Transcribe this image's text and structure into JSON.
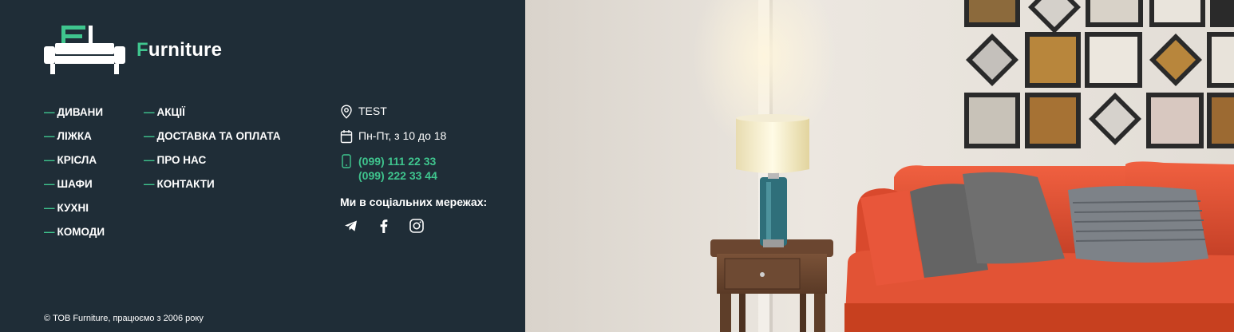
{
  "brand": {
    "name_first": "F",
    "name_rest": "urniture",
    "accent": "#3fc58e",
    "background": "#1f2d37"
  },
  "nav_col1": [
    {
      "dash": "—",
      "label": "ДИВАНИ"
    },
    {
      "dash": "—",
      "label": "ЛІЖКА"
    },
    {
      "dash": "—",
      "label": "КРІСЛА"
    },
    {
      "dash": "—",
      "label": "ШАФИ"
    },
    {
      "dash": "—",
      "label": "КУХНІ"
    },
    {
      "dash": "—",
      "label": "КОМОДИ"
    }
  ],
  "nav_col2": [
    {
      "dash": "—",
      "label": "АКЦІЇ"
    },
    {
      "dash": "—",
      "label": "ДОСТАВКА ТА ОПЛАТА"
    },
    {
      "dash": "—",
      "label": "ПРО НАС"
    },
    {
      "dash": "—",
      "label": "КОНТАКТИ"
    }
  ],
  "contacts": {
    "address": "TEST",
    "hours": "Пн-Пт, з 10 до 18",
    "phones": [
      "(099) 111 22 33",
      "(099) 222 33 44"
    ],
    "address_icon": "location-pin-icon",
    "hours_icon": "calendar-icon",
    "phone_icon": "mobile-phone-icon"
  },
  "social": {
    "title": "Ми в соціальних мережах:",
    "items": [
      "telegram-icon",
      "facebook-icon",
      "instagram-icon"
    ]
  },
  "copyright": "© ТОВ Furniture, працюємо з 2006 року",
  "hero_image": "living-room-with-orange-sofa-lamp-and-wall-art"
}
